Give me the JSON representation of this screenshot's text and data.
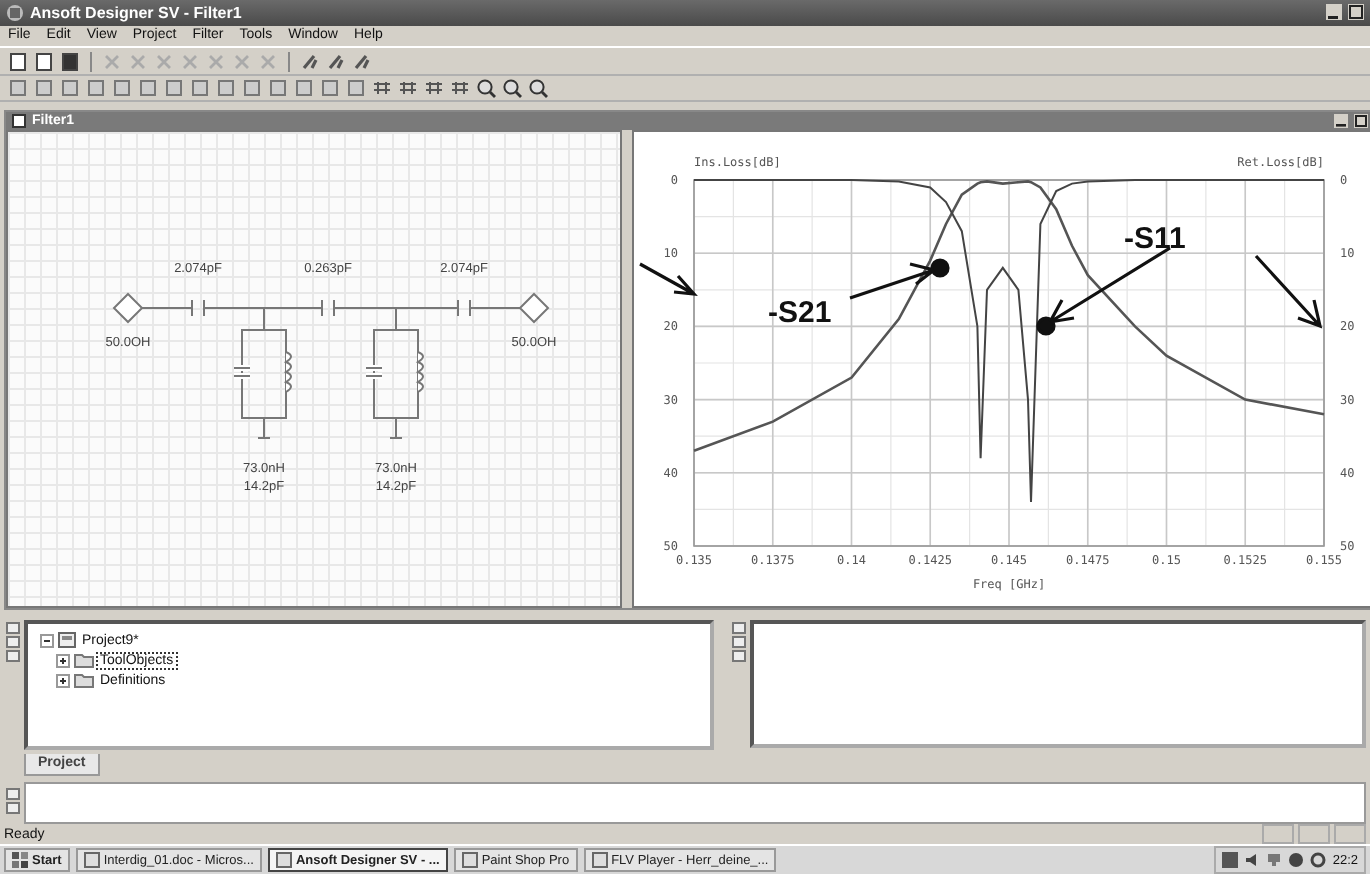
{
  "window": {
    "title": "Ansoft Designer SV - Filter1"
  },
  "menu": [
    "File",
    "Edit",
    "View",
    "Project",
    "Filter",
    "Tools",
    "Window",
    "Help"
  ],
  "document": {
    "title": "Filter1"
  },
  "schematic": {
    "series_capacitors": [
      "2.074pF",
      "0.263pF",
      "2.074pF"
    ],
    "ports": [
      "50.0OH",
      "50.0OH"
    ],
    "resonators": [
      {
        "inductance": "73.0nH",
        "capacitance": "14.2pF"
      },
      {
        "inductance": "73.0nH",
        "capacitance": "14.2pF"
      }
    ]
  },
  "plot": {
    "right_axis_label": "Ret.Loss[dB]",
    "right_yticks": [
      "0",
      "10",
      "20",
      "30",
      "40",
      "50"
    ],
    "chart_data": {
      "type": "line",
      "ylabel": "Ins.Loss[dB]",
      "xlabel": "Freq [GHz]",
      "x": [
        0.135,
        0.1375,
        0.14,
        0.1415,
        0.1425,
        0.143,
        0.1435,
        0.144,
        0.1441,
        0.1443,
        0.1448,
        0.1453,
        0.1456,
        0.1457,
        0.146,
        0.1465,
        0.147,
        0.1475,
        0.149,
        0.15,
        0.1525,
        0.155
      ],
      "grid": true,
      "series": [
        {
          "name": "-S21",
          "color": "#555555",
          "values": [
            37,
            33,
            27,
            19,
            11,
            6,
            2,
            0.5,
            0.3,
            0.2,
            0.5,
            0.3,
            0.2,
            0.3,
            1,
            4,
            9,
            13,
            20,
            24,
            30,
            32
          ]
        },
        {
          "name": "-S11",
          "color": "#444444",
          "values": [
            0,
            0,
            0,
            0.2,
            1,
            3,
            7,
            20,
            38,
            15,
            12,
            15,
            30,
            44,
            6,
            1.5,
            0.5,
            0.2,
            0,
            0,
            0,
            0
          ]
        }
      ],
      "xlim": [
        0.135,
        0.155
      ],
      "ylim": [
        50,
        0
      ],
      "xticks": [
        0.135,
        0.1375,
        0.14,
        0.1425,
        0.145,
        0.1475,
        0.15,
        0.1525,
        0.155
      ],
      "yticks": [
        0,
        10,
        20,
        30,
        40,
        50
      ]
    }
  },
  "project_tree": [
    {
      "label": "Project9*",
      "expanded": true,
      "selected": false,
      "children": [
        {
          "label": "ToolObjects",
          "expanded": false,
          "selected": true
        },
        {
          "label": "Definitions",
          "expanded": false,
          "selected": false
        }
      ]
    }
  ],
  "project_tabs": [
    {
      "label": "Project",
      "selected": true
    }
  ],
  "status_bar": {
    "text": "Ready"
  },
  "taskbar": {
    "start": "Start",
    "items": [
      {
        "label": "Interdig_01.doc - Micros...",
        "selected": false
      },
      {
        "label": "Ansoft Designer SV - ...",
        "selected": true
      },
      {
        "label": "Paint Shop Pro",
        "selected": false
      },
      {
        "label": "FLV Player - Herr_deine_...",
        "selected": false
      }
    ],
    "clock": "22:2"
  }
}
